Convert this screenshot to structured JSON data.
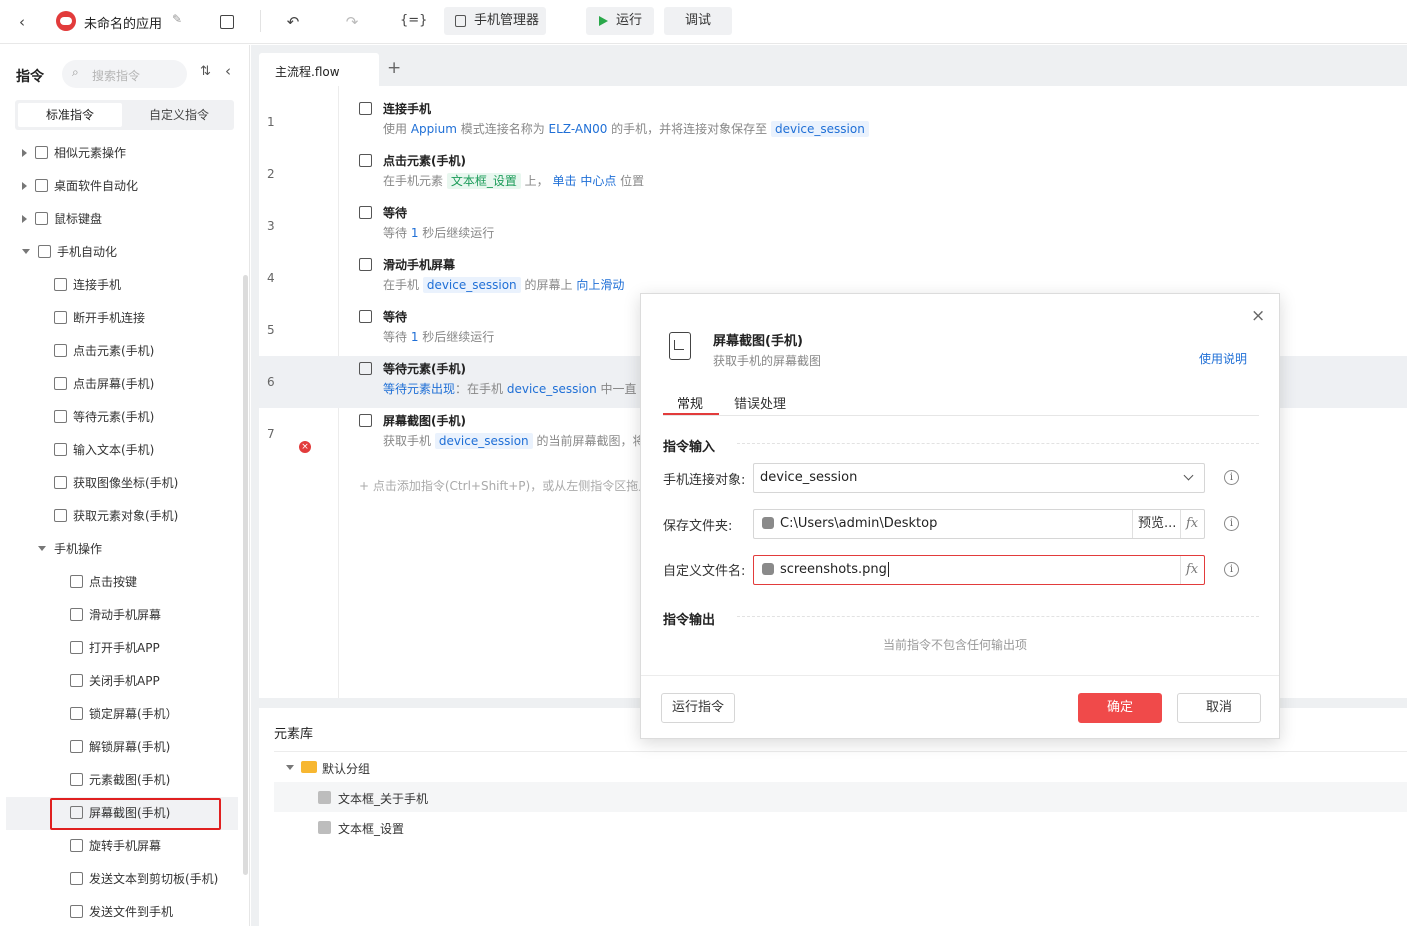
{
  "app": {
    "title": "未命名的应用",
    "toolbar": {
      "variables_label": "{=}",
      "phone_manager_label": "手机管理器",
      "run_label": "运行",
      "debug_label": "调试"
    }
  },
  "sidebar": {
    "title": "指令",
    "search_placeholder": "搜索指令",
    "tabs": [
      "标准指令",
      "自定义指令"
    ],
    "tree": [
      {
        "label": "相似元素操作",
        "level": 0,
        "caret": "right"
      },
      {
        "label": "桌面软件自动化",
        "level": 0,
        "caret": "right"
      },
      {
        "label": "鼠标键盘",
        "level": 0,
        "caret": "right"
      },
      {
        "label": "手机自动化",
        "level": 0,
        "caret": "down"
      },
      {
        "label": "连接手机",
        "level": 1
      },
      {
        "label": "断开手机连接",
        "level": 1
      },
      {
        "label": "点击元素(手机)",
        "level": 1
      },
      {
        "label": "点击屏幕(手机)",
        "level": 1
      },
      {
        "label": "等待元素(手机)",
        "level": 1
      },
      {
        "label": "输入文本(手机)",
        "level": 1
      },
      {
        "label": "获取图像坐标(手机)",
        "level": 1
      },
      {
        "label": "获取元素对象(手机)",
        "level": 1
      },
      {
        "label": "手机操作",
        "level": 1,
        "caret": "down"
      },
      {
        "label": "点击按键",
        "level": 2
      },
      {
        "label": "滑动手机屏幕",
        "level": 2
      },
      {
        "label": "打开手机APP",
        "level": 2
      },
      {
        "label": "关闭手机APP",
        "level": 2
      },
      {
        "label": "锁定屏幕(手机）",
        "level": 2
      },
      {
        "label": "解锁屏幕(手机)",
        "level": 2
      },
      {
        "label": "元素截图(手机)",
        "level": 2
      },
      {
        "label": "屏幕截图(手机)",
        "level": 2,
        "selected": true
      },
      {
        "label": "旋转手机屏幕",
        "level": 2
      },
      {
        "label": "发送文本到剪切板(手机)",
        "level": 2
      },
      {
        "label": "发送文件到手机",
        "level": 2
      }
    ]
  },
  "editor": {
    "tab_label": "主流程.flow",
    "add_tab": "+",
    "steps": [
      {
        "num": "1",
        "title": "连接手机",
        "desc": [
          [
            "使用 ",
            ""
          ],
          [
            "Appium",
            "blue"
          ],
          [
            " 模式连接名称为 ",
            ""
          ],
          [
            "ELZ-AN00",
            "blue"
          ],
          [
            " 的手机，并将连接对象保存至 ",
            ""
          ],
          [
            "device_session",
            "tag"
          ]
        ]
      },
      {
        "num": "2",
        "title": "点击元素(手机)",
        "desc": [
          [
            "在手机元素 ",
            ""
          ],
          [
            "文本框_设置",
            "tag-g"
          ],
          [
            " 上， ",
            ""
          ],
          [
            "单击",
            "blue"
          ],
          [
            " ",
            ""
          ],
          [
            "中心点",
            "blue"
          ],
          [
            " 位置",
            ""
          ]
        ]
      },
      {
        "num": "3",
        "title": "等待",
        "desc": [
          [
            "等待 ",
            ""
          ],
          [
            "1",
            "blue"
          ],
          [
            " 秒后继续运行",
            ""
          ]
        ]
      },
      {
        "num": "4",
        "title": "滑动手机屏幕",
        "desc": [
          [
            "在手机 ",
            ""
          ],
          [
            "device_session",
            "tag"
          ],
          [
            " 的屏幕上 ",
            ""
          ],
          [
            "向上滑动",
            "blue"
          ]
        ]
      },
      {
        "num": "5",
        "title": "等待",
        "desc": [
          [
            "等待 ",
            ""
          ],
          [
            "1",
            "blue"
          ],
          [
            " 秒后继续运行",
            ""
          ]
        ]
      },
      {
        "num": "6",
        "title": "等待元素(手机)",
        "desc": [
          [
            "等待元素出现",
            "blue"
          ],
          [
            "：在手机 ",
            ""
          ],
          [
            "device_session",
            "blue"
          ],
          [
            " 中一直",
            ""
          ]
        ]
      },
      {
        "num": "7",
        "title": "屏幕截图(手机)",
        "desc": [
          [
            "获取手机 ",
            ""
          ],
          [
            "device_session",
            "tag"
          ],
          [
            " 的当前屏幕截图，将",
            ""
          ]
        ]
      }
    ],
    "add_hint": "+ 点击添加指令(Ctrl+Shift+P)，或从左侧指令区拖入"
  },
  "element_library": {
    "title": "元素库",
    "group": "默认分组",
    "items": [
      "文本框_关于手机",
      "文本框_设置"
    ]
  },
  "dialog": {
    "title": "屏幕截图(手机)",
    "subtitle": "获取手机的屏幕截图",
    "help_link": "使用说明",
    "tabs": [
      "常规",
      "错误处理"
    ],
    "input_section": "指令输入",
    "fields": {
      "device_label": "手机连接对象:",
      "device_value": "device_session",
      "folder_label": "保存文件夹:",
      "folder_value": "C:\\Users\\admin\\Desktop",
      "browse_label": "预览...",
      "filename_label": "自定义文件名:",
      "filename_value": "screenshots.png",
      "fx": "fx"
    },
    "output_section": "指令输出",
    "output_empty": "当前指令不包含任何输出项",
    "run_button": "运行指令",
    "ok_button": "确定",
    "cancel_button": "取消",
    "colors": {
      "primary": "#f04a4a",
      "link": "#1f6fd6",
      "active_tab": "#e23b3b"
    }
  }
}
